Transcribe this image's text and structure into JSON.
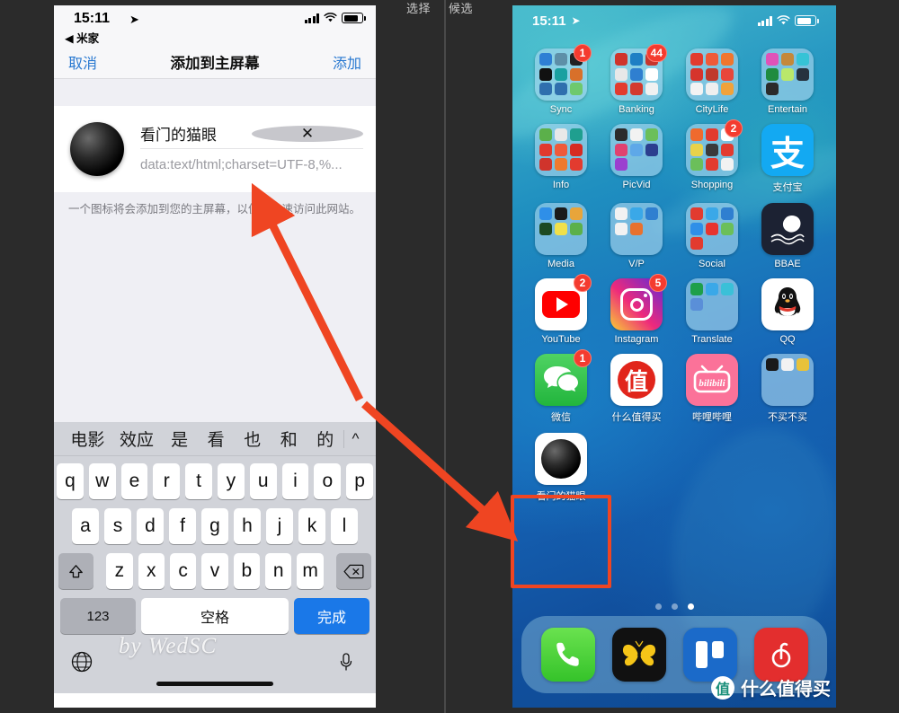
{
  "gap": {
    "labels": [
      "选择",
      "候选"
    ]
  },
  "left_phone": {
    "status": {
      "time": "15:11",
      "location_icon": "location-arrow-icon",
      "back_label": "◀ 米家"
    },
    "navbar": {
      "cancel": "取消",
      "title": "添加到主屏幕",
      "add": "添加"
    },
    "form": {
      "name_value": "看门的猫眼",
      "url_value": "data:text/html;charset=UTF-8,%...",
      "clear_icon": "clear-circle-icon",
      "app_icon": "peephole-camera-icon"
    },
    "description": "一个图标将会添加到您的主屏幕，以便您快速访问此网站。",
    "keyboard": {
      "candidates": [
        "电影",
        "效应",
        "是",
        "看",
        "也",
        "和",
        "的"
      ],
      "expand_icon": "chevron-up-icon",
      "row1": [
        "q",
        "w",
        "e",
        "r",
        "t",
        "y",
        "u",
        "i",
        "o",
        "p"
      ],
      "row2": [
        "a",
        "s",
        "d",
        "f",
        "g",
        "h",
        "j",
        "k",
        "l"
      ],
      "row3": [
        "z",
        "x",
        "c",
        "v",
        "b",
        "n",
        "m"
      ],
      "shift_icon": "shift-up-icon",
      "delete_icon": "backspace-icon",
      "numbers_key": "123",
      "space_key": "空格",
      "done_key": "完成",
      "globe_icon": "globe-icon",
      "mic_icon": "microphone-icon"
    },
    "watermark": "by WedSC"
  },
  "right_phone": {
    "status": {
      "time": "15:11",
      "location_icon": "location-arrow-icon"
    },
    "rows": [
      [
        {
          "label": "Sync",
          "type": "folder",
          "badge": "1",
          "minis": [
            "#2e7fd4",
            "#5d8fa8",
            "#222222",
            "#111111",
            "#1aa0a0",
            "#d8702a",
            "#2f6fae",
            "#2f6fae",
            "#6ec96e"
          ]
        },
        {
          "label": "Banking",
          "type": "folder",
          "badge": "44",
          "minis": [
            "#d0342c",
            "#1e7fc4",
            "#c7352d",
            "#e8e8e8",
            "#2f7fd0",
            "#ffffff",
            "#e23b2f",
            "#d33a2f",
            "#f1f1f1"
          ]
        },
        {
          "label": "CityLife",
          "type": "folder",
          "badge": "",
          "minis": [
            "#e23b2f",
            "#ef5a3a",
            "#f0762e",
            "#d6342c",
            "#c0392b",
            "#e8463a",
            "#f3f3f3",
            "#efefef",
            "#f0a23a"
          ]
        },
        {
          "label": "Entertain",
          "type": "folder",
          "badge": "",
          "minis": [
            "#e052b8",
            "#c4883a",
            "#36c3d6",
            "#1f8b3f",
            "#b9e86a",
            "#26323f",
            "#2b2b2b",
            "",
            ""
          ]
        }
      ],
      [
        {
          "label": "Info",
          "type": "folder",
          "badge": "",
          "minis": [
            "#5bb04a",
            "#e8e8e8",
            "#1f9f8f",
            "#e03a2e",
            "#ef5a3a",
            "#d62b22",
            "#d0342c",
            "#ef7a2e",
            "#e23b2f"
          ]
        },
        {
          "label": "PicVid",
          "type": "folder",
          "badge": "",
          "minis": [
            "#2b2b2b",
            "#f2f2f2",
            "#6bbf5a",
            "#e0426f",
            "#5ea8e8",
            "#2c3f8f",
            "#9b3fcf",
            "",
            ""
          ]
        },
        {
          "label": "Shopping",
          "type": "folder",
          "badge": "2",
          "minis": [
            "#ef6a2e",
            "#e23b2f",
            "#ffffff",
            "#e8d24a",
            "#3a3a3a",
            "#e23b2f",
            "#6bbf5a",
            "#e23b2f",
            "#f2f2f2"
          ]
        },
        {
          "label": "支付宝",
          "type": "app",
          "badge": "",
          "icon": "alipay-icon"
        }
      ],
      [
        {
          "label": "Media",
          "type": "folder",
          "badge": "",
          "minis": [
            "#2f8fe8",
            "#1a1a1a",
            "#e8a53a",
            "#1c4a22",
            "#f0e04a",
            "#5bb04a",
            "",
            "",
            ""
          ]
        },
        {
          "label": "V/P",
          "type": "folder",
          "badge": "",
          "minis": [
            "#f2f2f2",
            "#3aa8e8",
            "#2f7fd0",
            "#f2f2f2",
            "#e8712e",
            "",
            "",
            "",
            ""
          ]
        },
        {
          "label": "Social",
          "type": "folder",
          "badge": "",
          "minis": [
            "#e23b2f",
            "#3aa8e8",
            "#2f7fd0",
            "#2f8fe8",
            "#e8342e",
            "#6bbf5a",
            "#e23b2f",
            "",
            ""
          ]
        },
        {
          "label": "BBAE",
          "type": "app",
          "badge": "",
          "icon": "bbae-icon"
        }
      ],
      [
        {
          "label": "YouTube",
          "type": "app",
          "badge": "2",
          "icon": "youtube-icon"
        },
        {
          "label": "Instagram",
          "type": "app",
          "badge": "5",
          "icon": "instagram-icon"
        },
        {
          "label": "Translate",
          "type": "folder",
          "badge": "",
          "minis": [
            "#1e9f4a",
            "#3aa8e8",
            "#3ac0d8",
            "#5a8fd8",
            "",
            "",
            "",
            "",
            ""
          ]
        },
        {
          "label": "QQ",
          "type": "app",
          "badge": "",
          "icon": "qq-icon"
        }
      ],
      [
        {
          "label": "微信",
          "type": "app",
          "badge": "1",
          "icon": "wechat-icon"
        },
        {
          "label": "什么值得买",
          "type": "app",
          "badge": "",
          "icon": "smzdm-icon"
        },
        {
          "label": "哔哩哔哩",
          "type": "app",
          "badge": "",
          "icon": "bilibili-icon"
        },
        {
          "label": "不买不买",
          "type": "folder",
          "badge": "",
          "minis": [
            "#1a1a1a",
            "#f2f2f2",
            "#e8c23a",
            "",
            "",
            "",
            "",
            "",
            ""
          ]
        }
      ],
      [
        {
          "label": "看门的猫眼",
          "type": "app",
          "badge": "",
          "icon": "peephole-camera-icon"
        }
      ]
    ],
    "page_dots": {
      "count": 3,
      "active_index": 2
    },
    "dock": [
      {
        "label": "Phone",
        "icon": "phone-icon"
      },
      {
        "label": "Butterfly",
        "icon": "butterfly-icon"
      },
      {
        "label": "Trello",
        "icon": "trello-icon"
      },
      {
        "label": "NetEase Music",
        "icon": "netease-music-icon"
      }
    ],
    "watermark": {
      "logo": "值",
      "text": "什么值得买"
    }
  },
  "annotation": {
    "arrow_color": "#ef4522",
    "highlight_color": "#ef4522"
  }
}
